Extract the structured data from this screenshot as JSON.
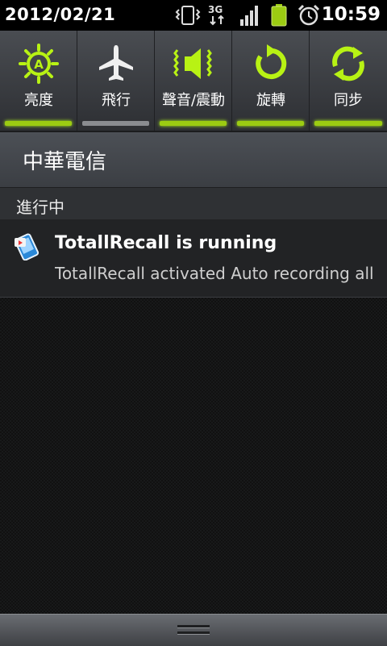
{
  "status_bar": {
    "date": "2012/02/21",
    "time": "10:59",
    "network_type": "3G",
    "icons": [
      "vibrate-icon",
      "3g-data-icon",
      "signal-icon",
      "battery-icon",
      "alarm-icon"
    ]
  },
  "quick_settings": {
    "items": [
      {
        "label": "亮度",
        "icon": "brightness-auto-icon",
        "state": "on"
      },
      {
        "label": "飛行",
        "icon": "airplane-icon",
        "state": "off"
      },
      {
        "label": "聲音/震動",
        "icon": "sound-vibrate-icon",
        "state": "on"
      },
      {
        "label": "旋轉",
        "icon": "rotate-icon",
        "state": "on"
      },
      {
        "label": "同步",
        "icon": "sync-icon",
        "state": "on"
      }
    ],
    "colors": {
      "active": "#9ccc12",
      "inactive": "#8a8c90"
    }
  },
  "carrier": {
    "name": "中華電信"
  },
  "ongoing": {
    "header": "進行中"
  },
  "notifications": [
    {
      "icon": "totallrecall-app-icon",
      "title": "TotallRecall is running",
      "text": "TotallRecall activated Auto recording all calls"
    }
  ]
}
